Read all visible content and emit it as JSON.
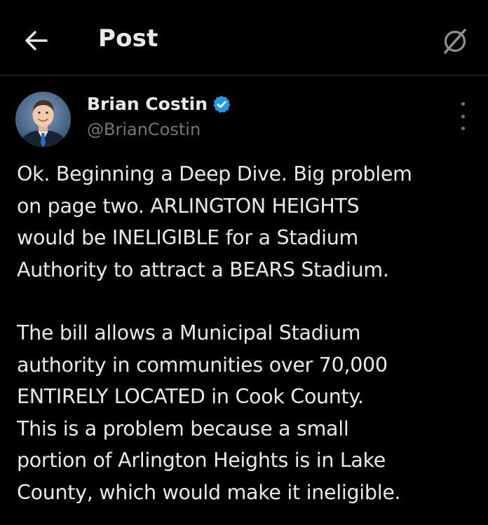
{
  "header": {
    "title": "Post",
    "back_icon": "arrow-left-icon",
    "grok_icon": "grok-icon"
  },
  "author": {
    "name": "Brian Costin",
    "handle": "@BrianCostin",
    "verified": true,
    "verified_color": "#1d9bf0"
  },
  "post": {
    "paragraphs": [
      "Ok. Beginning a Deep Dive. Big problem\non page two. ARLINGTON HEIGHTS\nwould be INELIGIBLE for a Stadium\nAuthority to attract a BEARS Stadium.",
      "The bill allows a Municipal Stadium\nauthority  in communities over 70,000\nENTIRELY LOCATED in Cook County.\nThis is a problem because a small\nportion of Arlington Heights is in Lake\nCounty, which would make it ineligible."
    ]
  },
  "colors": {
    "background": "#000000",
    "text": "#e7e9ea",
    "secondary_text": "#71767b",
    "divider": "#2f3336",
    "accent": "#1d9bf0"
  }
}
